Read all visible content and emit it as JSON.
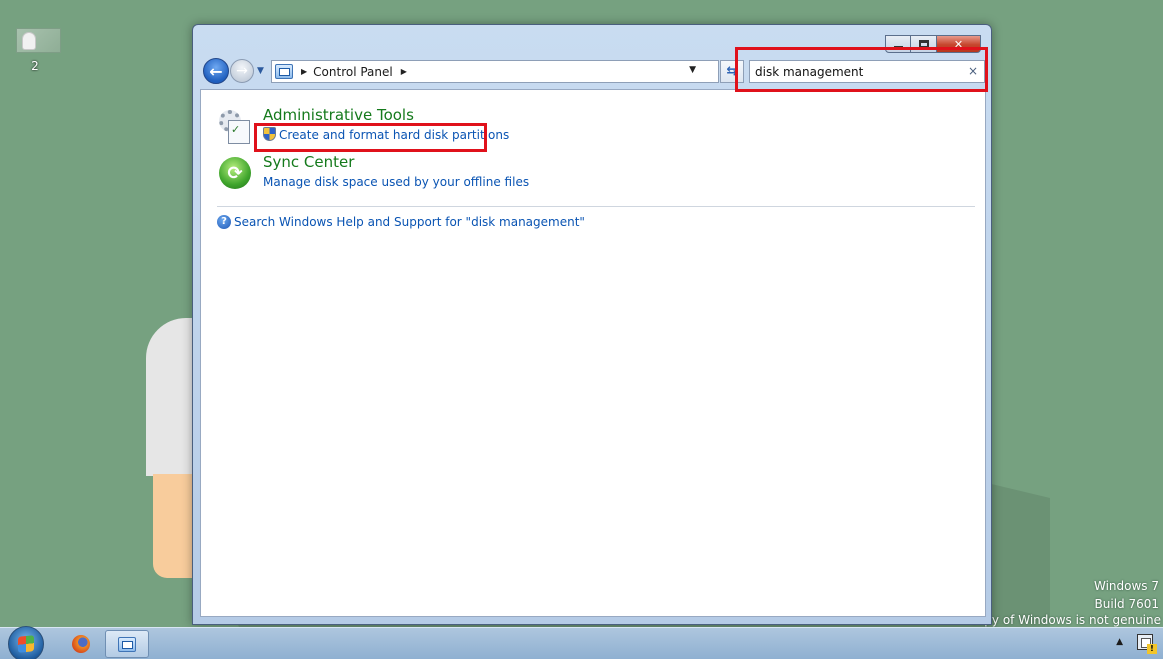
{
  "desktop": {
    "icon_label": "2",
    "watermark": {
      "line1": "Windows 7",
      "line2": "Build 7601",
      "line3": "copy of Windows is not genuine"
    }
  },
  "window": {
    "breadcrumb": [
      "Control Panel"
    ],
    "search": {
      "value": "disk management",
      "clear_glyph": "×"
    }
  },
  "results": [
    {
      "title": "Administrative Tools",
      "link": "Create and format hard disk partitions",
      "icon": "admin-tools-icon",
      "link_icon": "shield-icon"
    },
    {
      "title": "Sync Center",
      "link": "Manage disk space used by your offline files",
      "icon": "sync-center-icon"
    }
  ],
  "help": {
    "text": "Search Windows Help and Support for \"disk management\"",
    "icon": "help-icon"
  },
  "colors": {
    "desktop_bg": "#76a180",
    "title_green": "#157a1c",
    "link_blue": "#0a54b3",
    "highlight_red": "#e0111b"
  },
  "taskbar": {
    "items": [
      "start-button",
      "firefox-icon",
      "control-panel-icon"
    ]
  }
}
